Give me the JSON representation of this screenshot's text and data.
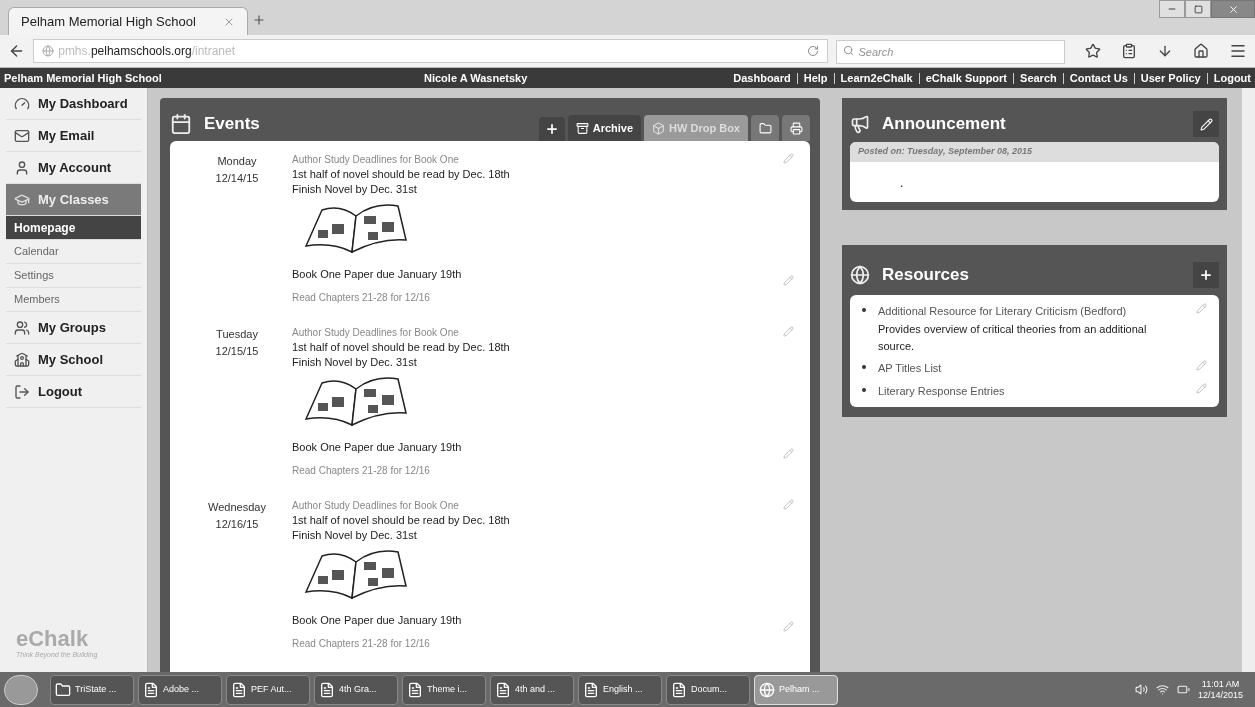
{
  "browser": {
    "tab_title": "Pelham Memorial High School",
    "url_prefix": "pmhs.",
    "url_domain": "pelhamschools.org",
    "url_path": "/intranet",
    "search_placeholder": "Search"
  },
  "site_bar": {
    "school": "Pelham Memorial High School",
    "user": "Nicole A Wasnetsky",
    "links": [
      "Dashboard",
      "Help",
      "Learn2eChalk",
      "eChalk Support",
      "Search",
      "Contact Us",
      "User Policy",
      "Logout"
    ]
  },
  "sidebar": {
    "items": [
      {
        "label": "My Dashboard",
        "selected": false,
        "kind": "dashboard"
      },
      {
        "label": "My Email",
        "selected": false,
        "kind": "email"
      },
      {
        "label": "My Account",
        "selected": false,
        "kind": "account"
      },
      {
        "label": "My Classes",
        "selected": true,
        "kind": "classes",
        "children": [
          {
            "label": "Homepage",
            "selected": true
          },
          {
            "label": "Calendar",
            "selected": false
          },
          {
            "label": "Settings",
            "selected": false
          },
          {
            "label": "Members",
            "selected": false
          }
        ]
      },
      {
        "label": "My Groups",
        "selected": false,
        "kind": "groups"
      },
      {
        "label": "My School",
        "selected": false,
        "kind": "school"
      },
      {
        "label": "Logout",
        "selected": false,
        "kind": "logout"
      }
    ],
    "logo": "eChalk",
    "tagline": "Think Beyond the Building"
  },
  "events": {
    "title": "Events",
    "tabs": [
      {
        "label": "Archive",
        "selected": false
      },
      {
        "label": "HW Drop Box",
        "selected": true
      }
    ],
    "items": [
      {
        "day": "Monday",
        "date": "12/14/15",
        "title": "Author Study Deadlines for Book One",
        "lines": [
          "1st half of novel should be read by Dec. 18th",
          "Finish Novel by Dec. 31st"
        ],
        "paper": "Book One Paper due January 19th",
        "note": "Read Chapters 21-28 for 12/16"
      },
      {
        "day": "Tuesday",
        "date": "12/15/15",
        "title": "Author Study Deadlines for Book One",
        "lines": [
          "1st half of novel should be read by Dec. 18th",
          "Finish Novel by Dec. 31st"
        ],
        "paper": "Book One Paper due January 19th",
        "note": "Read Chapters 21-28 for 12/16"
      },
      {
        "day": "Wednesday",
        "date": "12/16/15",
        "title": "Author Study Deadlines for Book One",
        "lines": [
          "1st half of novel should be read by Dec. 18th",
          "Finish Novel by Dec. 31st"
        ],
        "paper": "Book One Paper due January 19th",
        "note": "Read Chapters 21-28 for 12/16"
      }
    ]
  },
  "announcement": {
    "title": "Announcement",
    "posted": "Posted on: Tuesday, September 08, 2015",
    "body": "."
  },
  "resources": {
    "title": "Resources",
    "items": [
      {
        "title": "Additional Resource for Literary Criticism (Bedford)",
        "description": "Provides overview of critical theories from an additional source."
      },
      {
        "title": "AP Titles List"
      },
      {
        "title": "Literary Response Entries"
      }
    ]
  },
  "taskbar": {
    "items": [
      {
        "label": "TriState ...",
        "kind": "folder",
        "selected": false
      },
      {
        "label": "Adobe ...",
        "kind": "pdf",
        "selected": false
      },
      {
        "label": "PEF Aut...",
        "kind": "word",
        "selected": false
      },
      {
        "label": "4th Gra...",
        "kind": "word",
        "selected": false
      },
      {
        "label": "Theme i...",
        "kind": "word",
        "selected": false
      },
      {
        "label": "4th and ...",
        "kind": "word",
        "selected": false
      },
      {
        "label": "English ...",
        "kind": "word",
        "selected": false
      },
      {
        "label": "Docum...",
        "kind": "word",
        "selected": false
      },
      {
        "label": "Pelham ...",
        "kind": "browser",
        "selected": true
      }
    ],
    "time": "11:01 AM",
    "date": "12/14/2015"
  }
}
